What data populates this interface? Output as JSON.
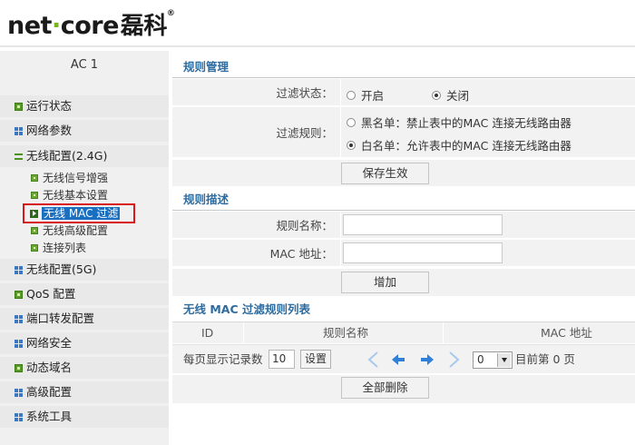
{
  "header": {
    "logo_text_net": "net",
    "logo_dot": "·",
    "logo_text_core": "core",
    "logo_cn": "磊科",
    "logo_reg": "®"
  },
  "sidebar": {
    "title": "AC 1",
    "items": [
      {
        "label": "运行状态"
      },
      {
        "label": "网络参数"
      },
      {
        "label": "无线配置(2.4G)"
      },
      {
        "label": "无线配置(5G)"
      },
      {
        "label": "QoS 配置"
      },
      {
        "label": "端口转发配置"
      },
      {
        "label": "网络安全"
      },
      {
        "label": "动态域名"
      },
      {
        "label": "高级配置"
      },
      {
        "label": "系统工具"
      }
    ],
    "subitems": [
      {
        "label": "无线信号增强"
      },
      {
        "label": "无线基本设置"
      },
      {
        "label": "无线 MAC 过滤"
      },
      {
        "label": "无线高级配置"
      },
      {
        "label": "连接列表"
      }
    ]
  },
  "rule_mgmt": {
    "title": "规则管理",
    "filter_status_label": "过滤状态：",
    "status_on": "开启",
    "status_off": "关闭",
    "selected_status": "关闭",
    "filter_rule_label": "过滤规则：",
    "rule_blacklist": "黑名单：禁止表中的MAC 连接无线路由器",
    "rule_whitelist": "白名单：允许表中的MAC 连接无线路由器",
    "selected_rule": "白名单",
    "save_button": "保存生效"
  },
  "rule_desc": {
    "title": "规则描述",
    "name_label": "规则名称：",
    "name_value": "",
    "mac_label": "MAC 地址：",
    "mac_value": "",
    "add_button": "增加"
  },
  "rule_list": {
    "title": "无线 MAC 过滤规则列表",
    "columns": [
      "ID",
      "规则名称",
      "MAC 地址"
    ],
    "rows": [],
    "per_page_label": "每页显示记录数",
    "per_page_value": "10",
    "set_button": "设置",
    "page_select_value": "0",
    "current_page_text": "目前第 0 页",
    "delete_all_button": "全部删除"
  },
  "colors": {
    "accent_title": "#2e6b9e",
    "highlight_border": "#d7191c",
    "active_item_bg": "#1a6fc0"
  }
}
